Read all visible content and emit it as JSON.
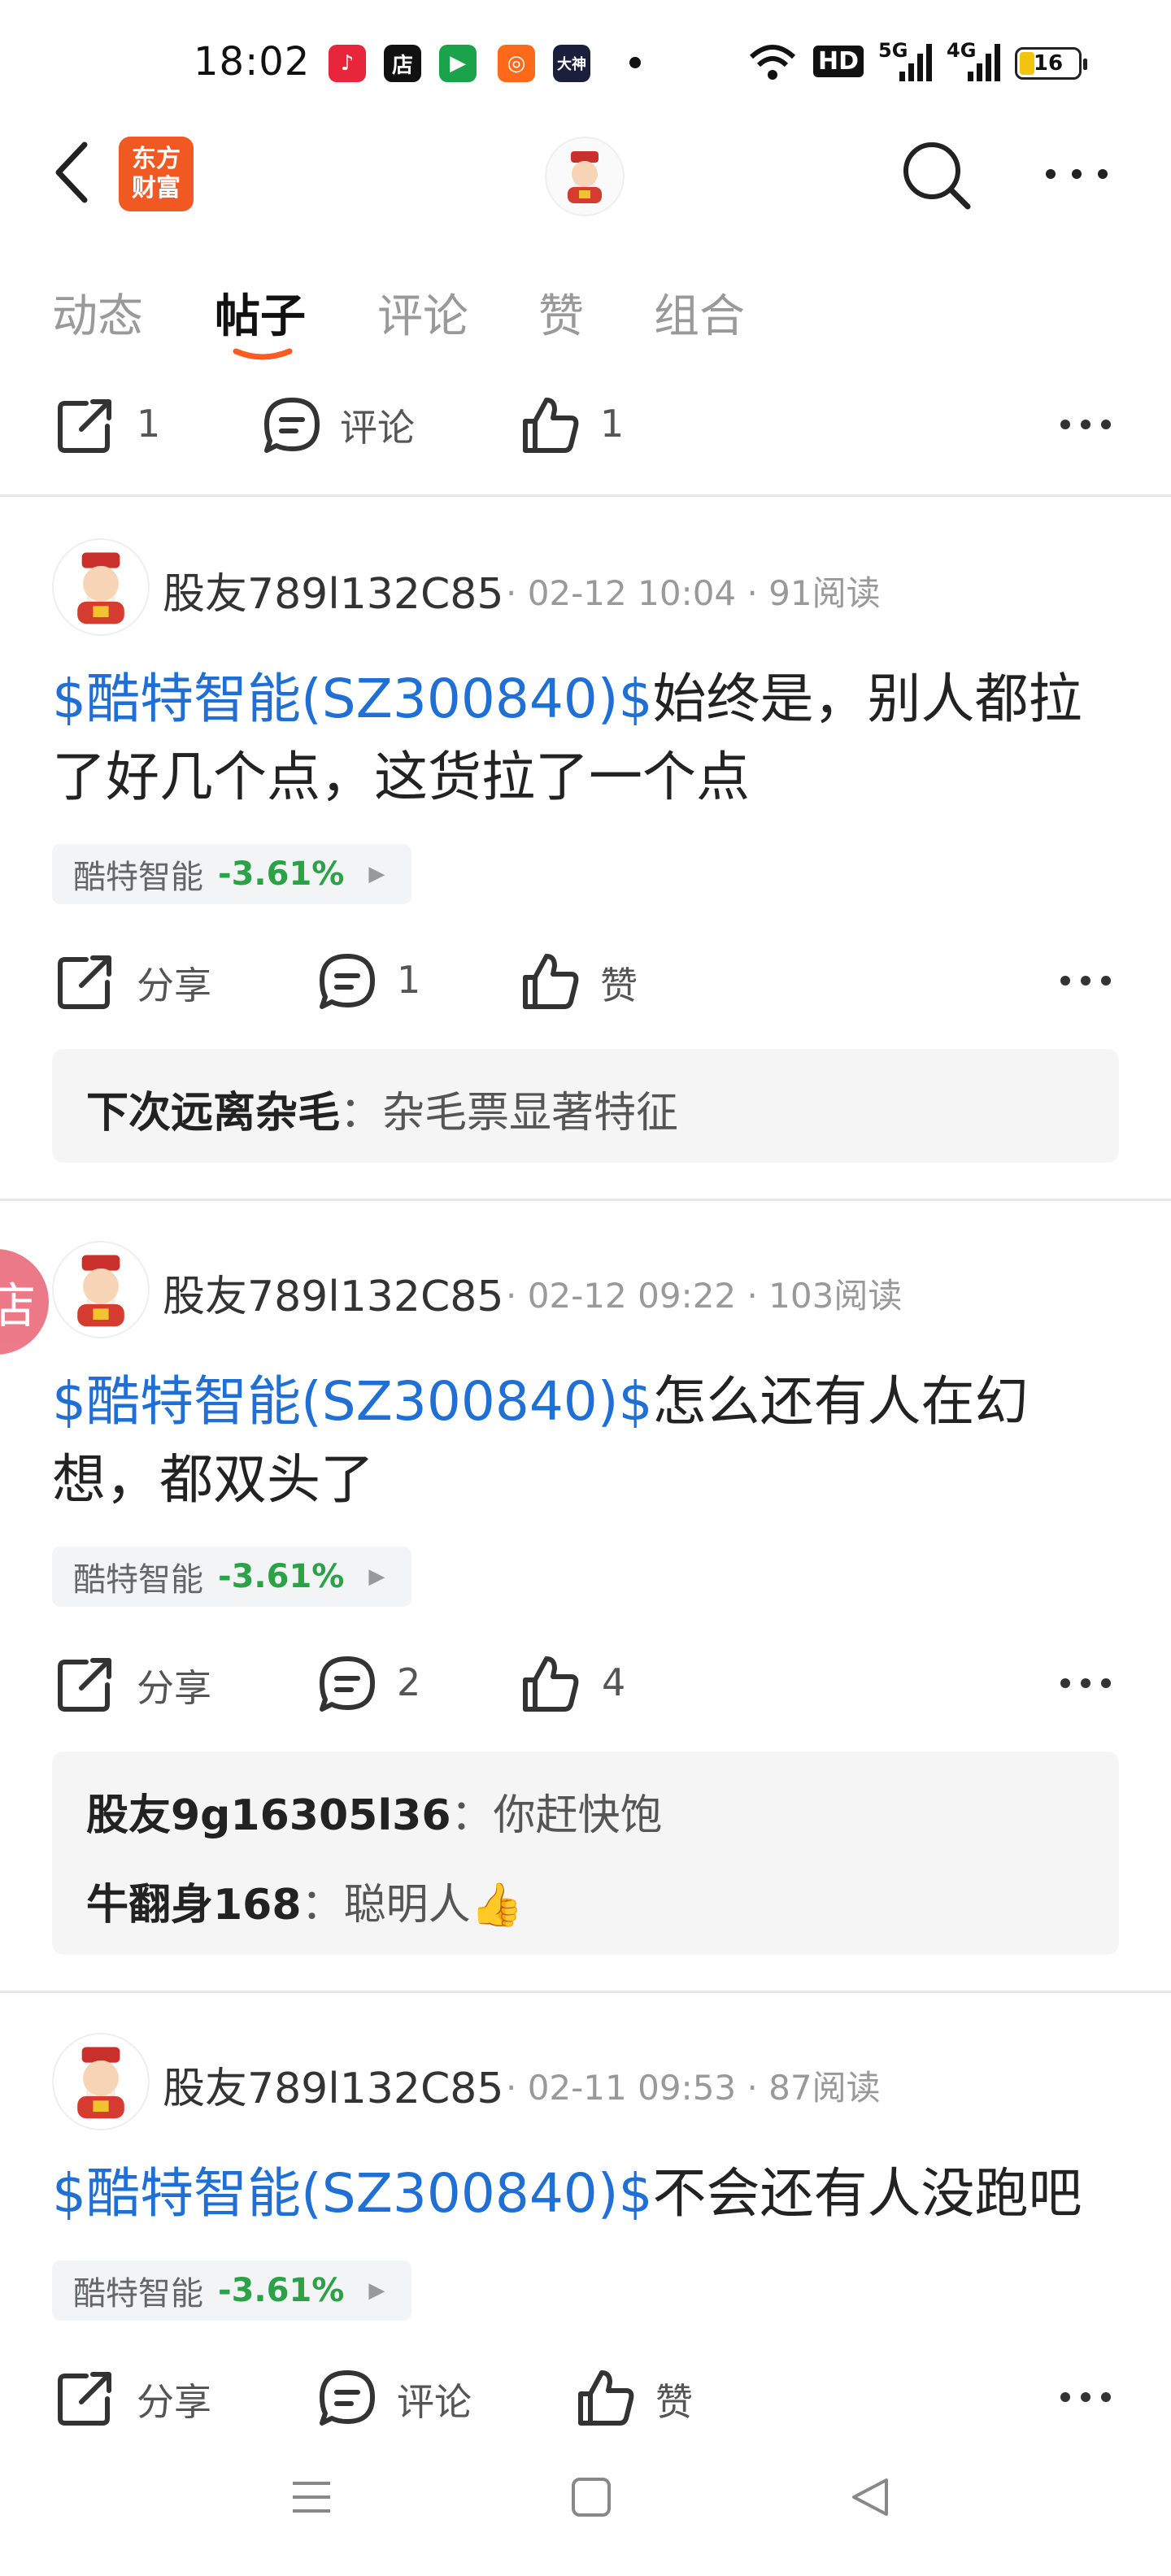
{
  "status_bar": {
    "time": "18:02",
    "apps": [
      {
        "icon": "music-app-icon",
        "glyph": "♪",
        "color": "#e8263b"
      },
      {
        "icon": "store-app-icon",
        "glyph": "店",
        "color": "#111111"
      },
      {
        "icon": "video-app-icon",
        "glyph": "▶",
        "color": "#1aa34a"
      },
      {
        "icon": "kuaishou-app-icon",
        "glyph": "◎",
        "color": "#ff6a1a"
      },
      {
        "icon": "dashen-app-icon",
        "glyph": "大神",
        "color": "#1b1f3b"
      }
    ],
    "hd": "HD",
    "net5g": "5G",
    "net4g": "4G",
    "battery": "16"
  },
  "header": {
    "logo_line1": "东方",
    "logo_line2": "财富"
  },
  "tabs": [
    {
      "label": "动态"
    },
    {
      "label": "帖子"
    },
    {
      "label": "评论"
    },
    {
      "label": "赞"
    },
    {
      "label": "组合"
    }
  ],
  "prev_post_actions": {
    "share": "1",
    "comment": "评论",
    "like": "1"
  },
  "posts": [
    {
      "user": "股友789l132C85",
      "meta": "· 02-12 10:04 · 91阅读",
      "tag": "$酷特智能(SZ300840)$",
      "text_line1": "始终是，别人都拉",
      "text_line2": "了好几个点，这货拉了一个点",
      "stock_name": "酷特智能",
      "stock_change": "-3.61%",
      "share": "分享",
      "comment": "1",
      "like": "赞",
      "comments": [
        {
          "user": "下次远离杂毛",
          "text": "杂毛票显著特征"
        }
      ]
    },
    {
      "user": "股友789l132C85",
      "meta": "· 02-12 09:22 · 103阅读",
      "tag": "$酷特智能(SZ300840)$",
      "text_line1": "怎么还有人在幻",
      "text_line2": "想，都双头了",
      "stock_name": "酷特智能",
      "stock_change": "-3.61%",
      "share": "分享",
      "comment": "2",
      "like": "4",
      "comments": [
        {
          "user": "股友9g16305l36",
          "text": "你赶快饱"
        },
        {
          "user": "牛翻身168",
          "text": "聪明人👍"
        }
      ]
    },
    {
      "user": "股友789l132C85",
      "meta": "· 02-11 09:53 · 87阅读",
      "tag": "$酷特智能(SZ300840)$",
      "text_line1": "不会还有人没跑吧",
      "stock_name": "酷特智能",
      "stock_change": "-3.61%",
      "share": "分享",
      "comment": "评论",
      "like": "赞"
    }
  ],
  "floating_badge": "店"
}
